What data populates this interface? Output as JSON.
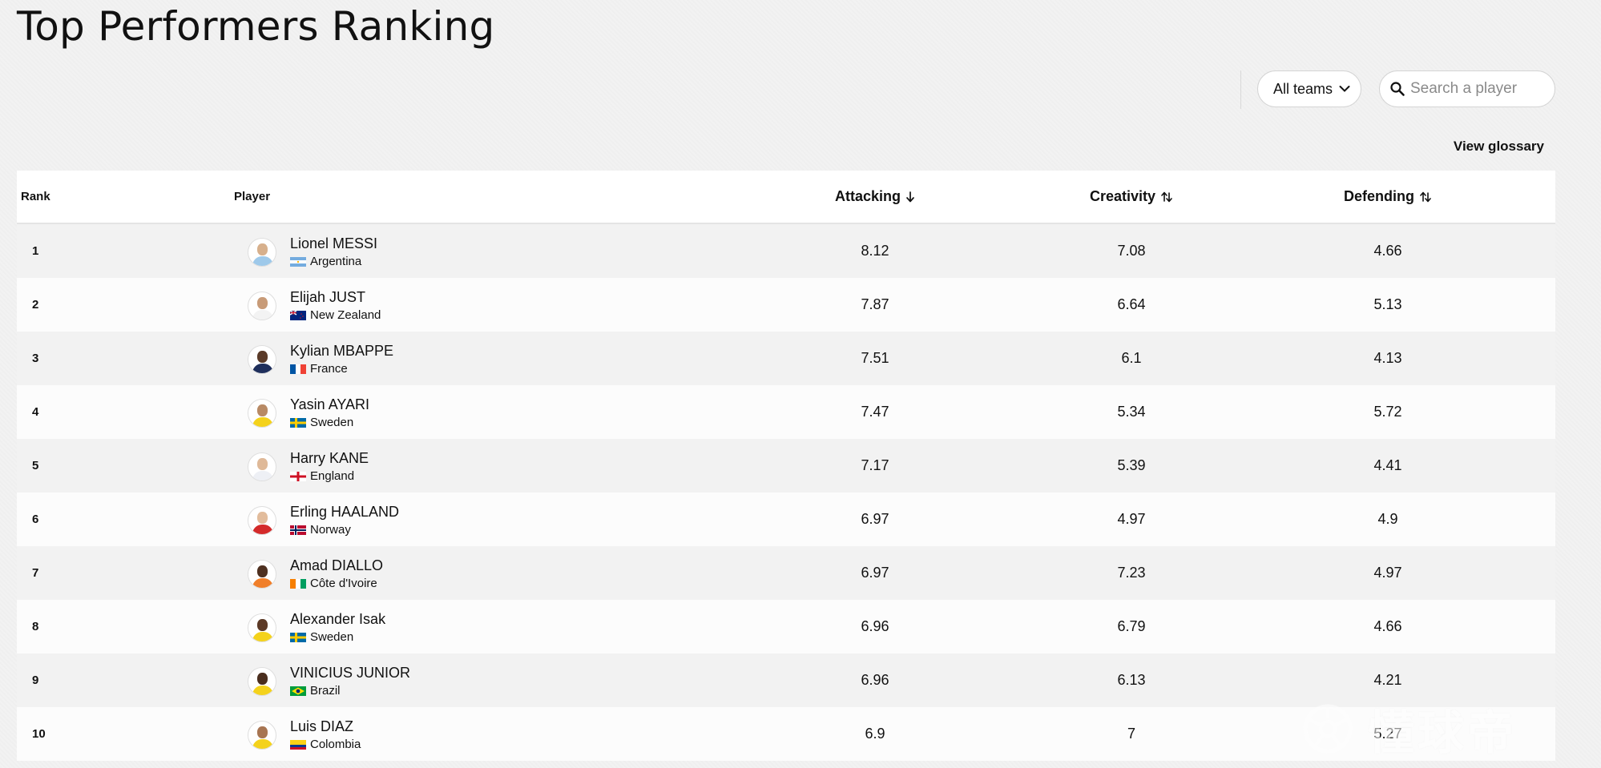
{
  "page": {
    "title": "Top Performers Ranking"
  },
  "filters": {
    "team_select_label": "All teams",
    "search_placeholder": "Search a player",
    "search_value": ""
  },
  "glossary_label": "View glossary",
  "columns": {
    "rank": "Rank",
    "player": "Player",
    "attacking": "Attacking",
    "creativity": "Creativity",
    "defending": "Defending"
  },
  "sort": {
    "attacking": "desc",
    "creativity": "none",
    "defending": "none"
  },
  "rows": [
    {
      "rank": "1",
      "name": "Lionel MESSI",
      "nation": "Argentina",
      "flag": "arg",
      "attacking": "8.12",
      "creativity": "7.08",
      "defending": "4.66",
      "skin": "#d7b08c",
      "shirt": "#9ec9ea"
    },
    {
      "rank": "2",
      "name": "Elijah JUST",
      "nation": "New Zealand",
      "flag": "nzl",
      "attacking": "7.87",
      "creativity": "6.64",
      "defending": "5.13",
      "skin": "#c89b78",
      "shirt": "#f3f3f3"
    },
    {
      "rank": "3",
      "name": "Kylian MBAPPE",
      "nation": "France",
      "flag": "fra",
      "attacking": "7.51",
      "creativity": "6.1",
      "defending": "4.13",
      "skin": "#5a3a28",
      "shirt": "#1f2f5c"
    },
    {
      "rank": "4",
      "name": "Yasin AYARI",
      "nation": "Sweden",
      "flag": "swe",
      "attacking": "7.47",
      "creativity": "5.34",
      "defending": "5.72",
      "skin": "#b88a65",
      "shirt": "#f4d21c"
    },
    {
      "rank": "5",
      "name": "Harry KANE",
      "nation": "England",
      "flag": "eng",
      "attacking": "7.17",
      "creativity": "5.39",
      "defending": "4.41",
      "skin": "#dfb998",
      "shirt": "#eef0f5"
    },
    {
      "rank": "6",
      "name": "Erling HAALAND",
      "nation": "Norway",
      "flag": "nor",
      "attacking": "6.97",
      "creativity": "4.97",
      "defending": "4.9",
      "skin": "#e2bc9c",
      "shirt": "#d42a2a"
    },
    {
      "rank": "7",
      "name": "Amad DIALLO",
      "nation": "Côte d'Ivoire",
      "flag": "civ",
      "attacking": "6.97",
      "creativity": "7.23",
      "defending": "4.97",
      "skin": "#4e3020",
      "shirt": "#f07f2a"
    },
    {
      "rank": "8",
      "name": "Alexander Isak",
      "nation": "Sweden",
      "flag": "swe",
      "attacking": "6.96",
      "creativity": "6.79",
      "defending": "4.66",
      "skin": "#5c3a26",
      "shirt": "#f4d21c"
    },
    {
      "rank": "9",
      "name": "VINICIUS JUNIOR",
      "nation": "Brazil",
      "flag": "bra",
      "attacking": "6.96",
      "creativity": "6.13",
      "defending": "4.21",
      "skin": "#4a2e1e",
      "shirt": "#f4d21c"
    },
    {
      "rank": "10",
      "name": "Luis DIAZ",
      "nation": "Colombia",
      "flag": "col",
      "attacking": "6.9",
      "creativity": "7",
      "defending": "5.27",
      "skin": "#a77552",
      "shirt": "#f4d21c"
    }
  ],
  "watermark": {
    "text": "懂球帝"
  },
  "colors": {
    "background": "#f2f2f2",
    "row_alt": "#fcfcfc",
    "text": "#111111"
  }
}
